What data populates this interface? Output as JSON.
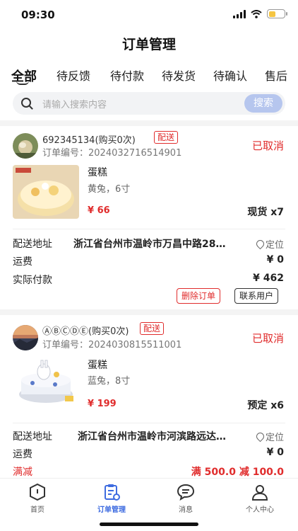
{
  "status_bar": {
    "time": "09:30"
  },
  "nav": {
    "title": "订单管理"
  },
  "tabs": [
    "全部",
    "待反馈",
    "待付款",
    "待发货",
    "待确认",
    "售后"
  ],
  "search": {
    "placeholder": "请输入搜索内容",
    "button": "搜索"
  },
  "orders": [
    {
      "buyer": "692345134(购买0次)",
      "tag": "配送",
      "order_no": "订单编号：2024032716514901",
      "status": "已取消",
      "product": {
        "name": "蛋糕",
        "spec": "黄兔，6寸",
        "price": "¥ 66",
        "qty": "现货 x7"
      },
      "address_label": "配送地址",
      "address": "浙江省台州市温岭市万昌中路28…",
      "locate": "定位",
      "shipping_label": "运费",
      "shipping": "¥ 0",
      "paid_label": "实际付款",
      "paid": "¥ 462",
      "buttons": {
        "delete": "删除订单",
        "contact": "联系用户"
      }
    },
    {
      "buyer": "ⒶⒷⒸⒹⒺ(购买0次)",
      "tag": "配送",
      "order_no": "订单编号：2024030815511001",
      "status": "已取消",
      "product": {
        "name": "蛋糕",
        "spec": "蓝兔，8寸",
        "price": "¥ 199",
        "qty": "预定 x6"
      },
      "address_label": "配送地址",
      "address": "浙江省台州市温岭市河滨路远达…",
      "locate": "定位",
      "shipping_label": "运费",
      "shipping": "¥ 0",
      "discount_label": "满减",
      "discount": "满 500.0 减 100.0"
    }
  ],
  "bottom_nav": [
    {
      "label": "首页",
      "icon": "home-icon"
    },
    {
      "label": "订单管理",
      "icon": "order-manage-icon",
      "active": true
    },
    {
      "label": "消息",
      "icon": "message-icon"
    },
    {
      "label": "个人中心",
      "icon": "profile-icon"
    }
  ],
  "colors": {
    "accent_red": "#e02c2c",
    "accent_blue": "#3d6be0",
    "search_button": "#b6c6ee"
  }
}
